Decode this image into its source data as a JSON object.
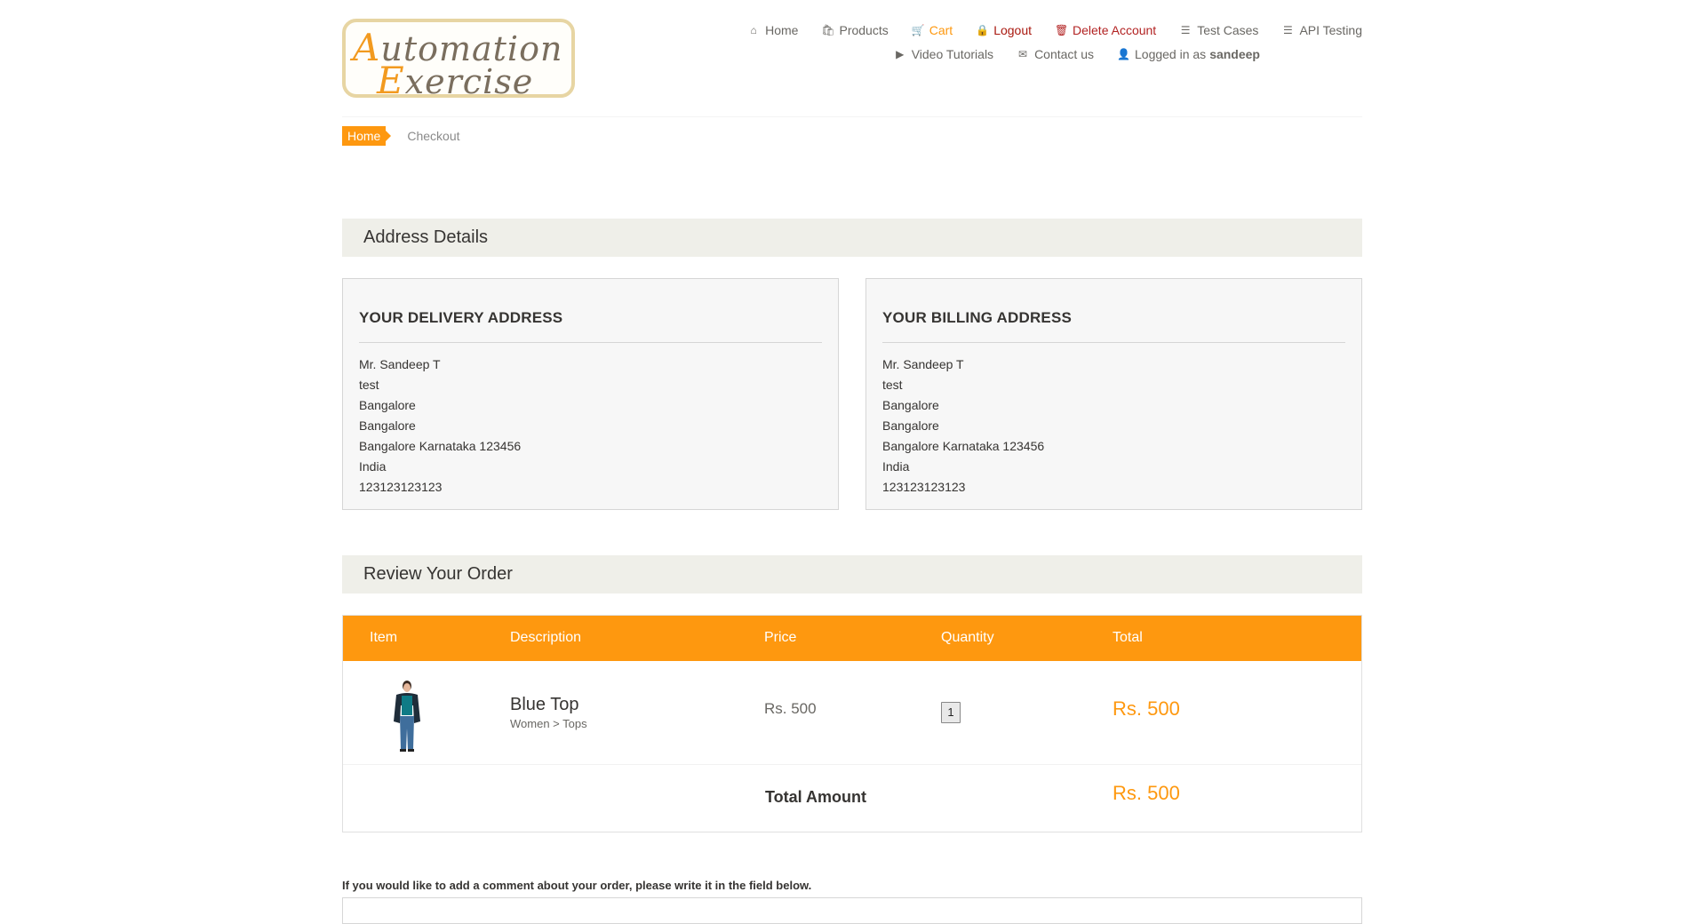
{
  "logo": {
    "line1_cap": "A",
    "line1_rest": "utomation",
    "line2_cap": "E",
    "line2_rest": "xercise"
  },
  "nav": {
    "row1": [
      {
        "label": "Home",
        "icon": "home-icon"
      },
      {
        "label": "Products",
        "icon": "products-icon"
      },
      {
        "label": "Cart",
        "icon": "cart-icon"
      },
      {
        "label": "Logout",
        "icon": "lock-icon"
      },
      {
        "label": "Delete Account",
        "icon": "trash-icon"
      },
      {
        "label": "Test Cases",
        "icon": "list-icon"
      },
      {
        "label": "API Testing",
        "icon": "list-icon"
      }
    ],
    "row2": [
      {
        "label": "Video Tutorials",
        "icon": "youtube-icon"
      },
      {
        "label": "Contact us",
        "icon": "envelope-icon"
      },
      {
        "label": "Logged in as",
        "icon": "user-icon",
        "username": "sandeep"
      }
    ]
  },
  "breadcrumb": {
    "home": "Home",
    "current": "Checkout"
  },
  "address_section": {
    "title": "Address Details"
  },
  "delivery": {
    "title": "YOUR DELIVERY ADDRESS",
    "lines": [
      "Mr. Sandeep T",
      "test",
      "Bangalore",
      "Bangalore",
      "Bangalore Karnataka 123456",
      "India",
      "123123123123"
    ]
  },
  "billing": {
    "title": "YOUR BILLING ADDRESS",
    "lines": [
      "Mr. Sandeep T",
      "test",
      "Bangalore",
      "Bangalore",
      "Bangalore Karnataka 123456",
      "India",
      "123123123123"
    ]
  },
  "review_section": {
    "title": "Review Your Order"
  },
  "order_table": {
    "headers": {
      "item": "Item",
      "description": "Description",
      "price": "Price",
      "quantity": "Quantity",
      "total": "Total"
    },
    "rows": [
      {
        "name": "Blue Top",
        "category": "Women > Tops",
        "price": "Rs. 500",
        "quantity": "1",
        "total": "Rs. 500"
      }
    ],
    "total_label": "Total Amount",
    "total_value": "Rs. 500"
  },
  "comment": {
    "label": "If you would like to add a comment about your order, please write it in the field below."
  },
  "colors": {
    "accent": "#fe980f",
    "section_bg": "#efefe9",
    "logout": "#a9180f"
  }
}
